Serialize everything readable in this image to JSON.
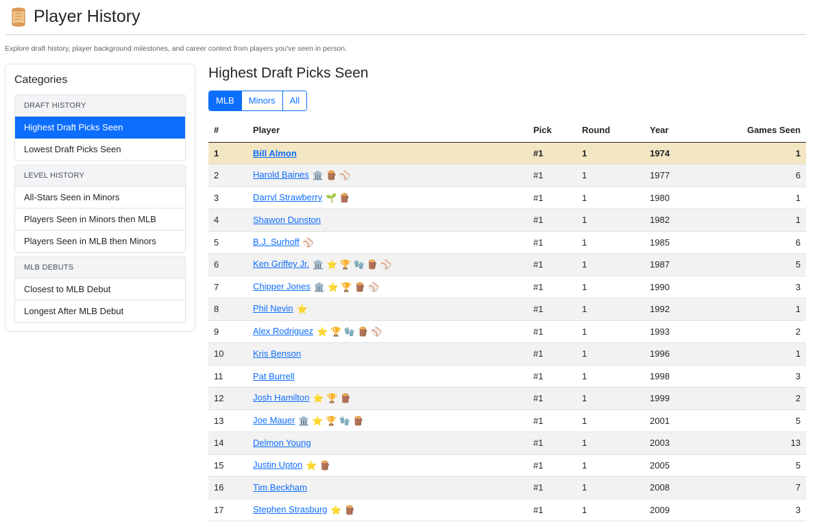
{
  "header": {
    "title": "Player History",
    "icon": "scroll-icon"
  },
  "subtitle": "Explore draft history, player background milestones, and career context from players you've seen in person.",
  "sidebar": {
    "title": "Categories",
    "groups": [
      {
        "header": "Draft History",
        "items": [
          "Highest Draft Picks Seen",
          "Lowest Draft Picks Seen"
        ]
      },
      {
        "header": "Level History",
        "items": [
          "All-Stars Seen in Minors",
          "Players Seen in Minors then MLB",
          "Players Seen in MLB then Minors"
        ]
      },
      {
        "header": "MLB Debuts",
        "items": [
          "Closest to MLB Debut",
          "Longest After MLB Debut"
        ]
      }
    ],
    "active_item": "Highest Draft Picks Seen"
  },
  "main": {
    "title": "Highest Draft Picks Seen",
    "filters": [
      "MLB",
      "Minors",
      "All"
    ],
    "active_filter": "MLB",
    "columns": [
      "#",
      "Player",
      "Pick",
      "Round",
      "Year",
      "Games Seen"
    ],
    "rows": [
      {
        "num": "1",
        "player": "Bill Almon",
        "badges": "",
        "pick": "#1",
        "round": "1",
        "year": "1974",
        "games": "1"
      },
      {
        "num": "2",
        "player": "Harold Baines",
        "badges": "🏛️ 🪵 ⚾",
        "pick": "#1",
        "round": "1",
        "year": "1977",
        "games": "6"
      },
      {
        "num": "3",
        "player": "Darryl Strawberry",
        "badges": "🌱 🪵",
        "pick": "#1",
        "round": "1",
        "year": "1980",
        "games": "1"
      },
      {
        "num": "4",
        "player": "Shawon Dunston",
        "badges": "",
        "pick": "#1",
        "round": "1",
        "year": "1982",
        "games": "1"
      },
      {
        "num": "5",
        "player": "B.J. Surhoff",
        "badges": "⚾",
        "pick": "#1",
        "round": "1",
        "year": "1985",
        "games": "6"
      },
      {
        "num": "6",
        "player": "Ken Griffey Jr.",
        "badges": "🏛️ ⭐ 🏆 🧤 🪵 ⚾",
        "pick": "#1",
        "round": "1",
        "year": "1987",
        "games": "5"
      },
      {
        "num": "7",
        "player": "Chipper Jones",
        "badges": "🏛️ ⭐ 🏆 🪵 ⚾",
        "pick": "#1",
        "round": "1",
        "year": "1990",
        "games": "3"
      },
      {
        "num": "8",
        "player": "Phil Nevin",
        "badges": "⭐",
        "pick": "#1",
        "round": "1",
        "year": "1992",
        "games": "1"
      },
      {
        "num": "9",
        "player": "Alex Rodriguez",
        "badges": "⭐ 🏆 🧤 🪵 ⚾",
        "pick": "#1",
        "round": "1",
        "year": "1993",
        "games": "2"
      },
      {
        "num": "10",
        "player": "Kris Benson",
        "badges": "",
        "pick": "#1",
        "round": "1",
        "year": "1996",
        "games": "1"
      },
      {
        "num": "11",
        "player": "Pat Burrell",
        "badges": "",
        "pick": "#1",
        "round": "1",
        "year": "1998",
        "games": "3"
      },
      {
        "num": "12",
        "player": "Josh Hamilton",
        "badges": "⭐ 🏆 🪵",
        "pick": "#1",
        "round": "1",
        "year": "1999",
        "games": "2"
      },
      {
        "num": "13",
        "player": "Joe Mauer",
        "badges": "🏛️ ⭐ 🏆 🧤 🪵",
        "pick": "#1",
        "round": "1",
        "year": "2001",
        "games": "5"
      },
      {
        "num": "14",
        "player": "Delmon Young",
        "badges": "",
        "pick": "#1",
        "round": "1",
        "year": "2003",
        "games": "13"
      },
      {
        "num": "15",
        "player": "Justin Upton",
        "badges": "⭐ 🪵",
        "pick": "#1",
        "round": "1",
        "year": "2005",
        "games": "5"
      },
      {
        "num": "16",
        "player": "Tim Beckham",
        "badges": "",
        "pick": "#1",
        "round": "1",
        "year": "2008",
        "games": "7"
      },
      {
        "num": "17",
        "player": "Stephen Strasburg",
        "badges": "⭐ 🪵",
        "pick": "#1",
        "round": "1",
        "year": "2009",
        "games": "3"
      }
    ],
    "highlight_row": "1"
  },
  "colors": {
    "accent": "#0d6efd",
    "highlight": "#f3e6c2",
    "stripe": "#f2f2f2"
  }
}
